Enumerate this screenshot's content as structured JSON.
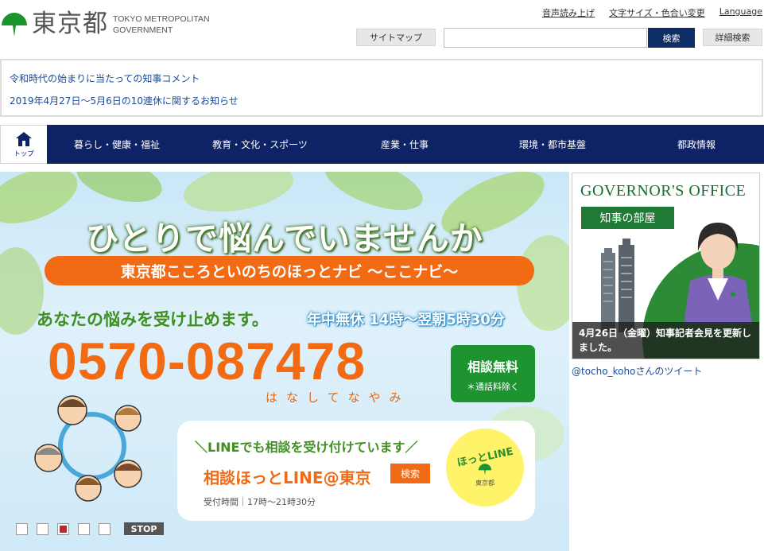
{
  "header": {
    "logo_jp": "東京都",
    "logo_en_line1": "TOKYO METROPOLITAN",
    "logo_en_line2": "GOVERNMENT",
    "util_links": [
      "音声読み上げ",
      "文字サイズ・色合い変更",
      "Language"
    ],
    "sitemap_label": "サイトマップ",
    "search_value": "",
    "search_button_label": "検索",
    "advanced_search_label": "詳細検索"
  },
  "notices": [
    "令和時代の始まりに当たっての知事コメント",
    "2019年4月27日～5月6日の10連休に関するお知らせ"
  ],
  "nav": {
    "home_label": "トップ",
    "items": [
      "暮らし・健康・福祉",
      "教育・文化・スポーツ",
      "産業・仕事",
      "環境・都市基盤",
      "都政情報"
    ]
  },
  "banner": {
    "title": "ひとりで悩んでいませんか",
    "pill": "東京都こころといのちのほっとナビ ～ここナビ～",
    "subtitle": "あなたの悩みを受け止めます。",
    "hours": "年中無休 14時～翌朝5時30分",
    "phone": "0570-087478",
    "mnemonic": "はなしてなやみ",
    "free_title": "相談無料",
    "free_note": "＊通話料除く",
    "line_intro": "＼LINEでも相談を受け付けています／",
    "line_name": "相談ほっとLINE@東京",
    "line_search": "検索",
    "line_hours": "受付時間｜17時～21時30分",
    "badge_title": "ほっとLINE",
    "badge_org": "東京都",
    "slider_active_index": 2,
    "slider_count": 5,
    "stop_label": "STOP"
  },
  "governor": {
    "title": "GOVERNOR'S OFFICE",
    "label": "知事の部屋",
    "caption": "4月26日（金曜）知事記者会見を更新しました。",
    "tweet_link": "@tocho_kohoさんのツイート"
  },
  "colors": {
    "brand_green": "#1e9430",
    "nav_navy": "#0e2266",
    "accent_orange": "#f26a14",
    "link_blue": "#1a4b9b"
  }
}
